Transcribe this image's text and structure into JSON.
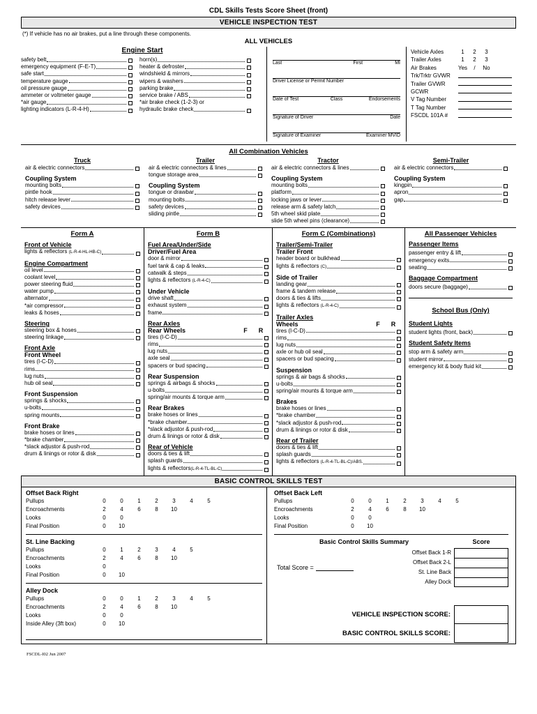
{
  "document": {
    "title": "CDL Skills Tests Score Sheet (front)",
    "band_vehicle_inspection": "VEHICLE INSPECTION TEST",
    "note": "(*) If vehicle has no air brakes, put a line through these components.",
    "all_vehicles_heading": "ALL VEHICLES",
    "band_basic_control": "BASIC CONTROL SKILLS TEST",
    "footer": "FSCDL-I02 Jun 2007"
  },
  "engine_start": {
    "title": "Engine Start",
    "left_items": [
      "safety belt",
      "emergency equipment (F-E-T)",
      "safe start",
      "temperature gauge",
      "oil pressure gauge",
      "ammeter or voltmeter gauge",
      "*air gauge",
      "lighting indicators (L-R-4-H)"
    ],
    "right_items": [
      "horn(s)",
      "heater & defroster",
      "windshield & mirrors",
      "wipers & washers",
      "parking brake",
      "service brake / ABS",
      "*air brake check (1-2-3) or",
      "hydraulic brake check"
    ]
  },
  "driver_form": {
    "name_labels": [
      "Last",
      "First",
      "MI"
    ],
    "license_label": "Driver License or Permit Number",
    "test_labels": [
      "Date of Test",
      "Class",
      "Endorsements"
    ],
    "driver_sig_labels": [
      "Signature of Driver",
      "Date"
    ],
    "examiner_sig_labels": [
      "Signature of Examiner",
      "Examiner MVID"
    ]
  },
  "vehicle_info": {
    "rows": [
      {
        "label": "Vehicle Axles",
        "options": [
          "1",
          "2",
          "3"
        ]
      },
      {
        "label": "Trailer Axles",
        "options": [
          "1",
          "2",
          "3"
        ]
      },
      {
        "label": "Air Brakes",
        "options": [
          "Yes",
          "/",
          "No"
        ]
      },
      {
        "label": "Trk/Trktr GVWR",
        "blank": true
      },
      {
        "label": "Trailer GVWR",
        "blank": true
      },
      {
        "label": "GCWR",
        "blank": true
      },
      {
        "label": "V Tag Number",
        "blank": true
      },
      {
        "label": "T Tag Number",
        "blank": true
      },
      {
        "label": "FSCDL 101A #",
        "blank": true
      }
    ]
  },
  "combination": {
    "heading": "All Combination Vehicles",
    "truck": {
      "title": "Truck",
      "items": [
        "air & electric connectors"
      ],
      "coupling_title": "Coupling System",
      "coupling_items": [
        "mounting bolts",
        "pintle hook",
        "hitch release lever",
        "safety devices"
      ]
    },
    "trailer": {
      "title": "Trailer",
      "items": [
        "air & electric connectors & lines",
        "tongue storage area"
      ],
      "coupling_title": "Coupling System",
      "coupling_items": [
        "tongue or drawbar",
        "mounting bolts",
        "safety devices",
        "sliding pintle"
      ]
    },
    "tractor": {
      "title": "Tractor",
      "items": [
        "air & electric connectors & lines"
      ],
      "coupling_title": "Coupling System",
      "coupling_items": [
        "mounting bolts",
        "platform",
        "locking jaws or lever",
        "release arm & safety latch",
        "5th wheel skid plate",
        "slide 5th wheel pins (clearance)"
      ]
    },
    "semi_trailer": {
      "title": "Semi-Trailer",
      "items": [
        "air & electric connectors"
      ],
      "coupling_title": "Coupling System",
      "coupling_items": [
        "kingpin",
        "apron",
        "gap"
      ]
    }
  },
  "form_a": {
    "title": "Form A",
    "groups": [
      {
        "heading": "Front of Vehicle",
        "items": [
          {
            "label": "lights & reflectors ",
            "small": "(L-R-4-HL-HB-C)"
          }
        ]
      },
      {
        "heading": "Engine Compartment",
        "items": [
          {
            "label": "oil level"
          },
          {
            "label": "coolant level"
          },
          {
            "label": "power steering fluid"
          },
          {
            "label": "water pump"
          },
          {
            "label": "alternator"
          },
          {
            "label": "*air compressor"
          },
          {
            "label": "leaks & hoses"
          }
        ]
      },
      {
        "heading": "Steering",
        "items": [
          {
            "label": "steering box & hoses"
          },
          {
            "label": "steering linkage"
          }
        ]
      },
      {
        "heading": "Front Axle",
        "subheading": "Front Wheel",
        "items": [
          {
            "label": "tires (I-C-D)"
          },
          {
            "label": "rims"
          },
          {
            "label": "lug nuts"
          },
          {
            "label": "hub oil seal"
          }
        ]
      },
      {
        "heading_plain": "Front Suspension",
        "items": [
          {
            "label": "springs & shocks"
          },
          {
            "label": "u-bolts"
          },
          {
            "label": "spring mounts"
          }
        ]
      },
      {
        "heading_plain": "Front Brake",
        "items": [
          {
            "label": "brake hoses or lines"
          },
          {
            "label": "*brake chamber"
          },
          {
            "label": "*slack adjustor & push-rod"
          },
          {
            "label": "drum & linings or rotor & disk"
          }
        ]
      }
    ]
  },
  "form_b": {
    "title": "Form B",
    "heading_fuel": "Fuel Area/Under/Side",
    "subheading_driver": "Driver/Fuel Area",
    "driver_items": [
      {
        "label": "door & mirror"
      },
      {
        "label": "fuel tank & cap & leaks"
      },
      {
        "label": "catwalk & steps"
      },
      {
        "label": "lights & reflectors ",
        "small": "(L-R-4-C)"
      }
    ],
    "under_vehicle_title": "Under Vehicle",
    "under_vehicle_items": [
      {
        "label": "drive shaft"
      },
      {
        "label": "exhaust system"
      },
      {
        "label": "frame"
      }
    ],
    "rear_axles_title": "Rear Axles",
    "rear_wheels_title": "Rear Wheels",
    "fr_labels": [
      "F",
      "R"
    ],
    "rear_wheel_items": [
      {
        "label": "tires (I-C-D)"
      },
      {
        "label": "rims"
      },
      {
        "label": "lug nuts"
      },
      {
        "label": "axle seal"
      },
      {
        "label": "spacers or bud spacing"
      }
    ],
    "rear_suspension_title": "Rear Suspension",
    "rear_suspension_items": [
      {
        "label": "springs & airbags & shocks"
      },
      {
        "label": "u-bolts"
      },
      {
        "label": "spring/air mounts & torque arm"
      }
    ],
    "rear_brakes_title": "Rear Brakes",
    "rear_brakes_items": [
      {
        "label": "brake hoses or lines"
      },
      {
        "label": "*brake chamber"
      },
      {
        "label": "*slack adjustor & push-rod"
      },
      {
        "label": "drum & linings or rotor & disk"
      }
    ],
    "rear_of_vehicle_title": "Rear of Vehicle",
    "rear_of_vehicle_items": [
      {
        "label": "doors & ties & lift"
      },
      {
        "label": "splash guards"
      },
      {
        "label": "lights & reflectors",
        "small": "(L-R-4-TL-BL-C)"
      }
    ]
  },
  "form_c": {
    "title": "Form C (Combinations)",
    "heading_trailer": "Trailer/Semi-Trailer",
    "subheading_front": "Trailer Front",
    "front_items": [
      {
        "label": "header board or bulkhead"
      },
      {
        "label": "lights & reflectors ",
        "small": "(C)"
      }
    ],
    "side_title": "Side of Trailer",
    "side_items": [
      {
        "label": "landing gear"
      },
      {
        "label": "frame & tandem release"
      },
      {
        "label": "doors & ties & lifts"
      },
      {
        "label": "lights & reflectors ",
        "small": "(L-R-4-C)"
      }
    ],
    "trailer_axles_title": "Trailer Axles",
    "wheels_title": "Wheels",
    "fr_labels": [
      "F",
      "R"
    ],
    "wheel_items": [
      {
        "label": "tires (I-C-D)"
      },
      {
        "label": "rims"
      },
      {
        "label": "lug nuts"
      },
      {
        "label": "axle or hub oil seal"
      },
      {
        "label": "spacers or bud spacing"
      }
    ],
    "suspension_title": "Suspension",
    "suspension_items": [
      {
        "label": "springs & air bags & shocks"
      },
      {
        "label": "u-bolts"
      },
      {
        "label": "spring/air mounts & torque arm"
      }
    ],
    "brakes_title": "Brakes",
    "brakes_items": [
      {
        "label": "brake hoses or lines"
      },
      {
        "label": "*brake chamber"
      },
      {
        "label": "*slack adjustor & push-rod"
      },
      {
        "label": "drum & linings or rotor & disk"
      }
    ],
    "rear_title": "Rear of Trailer",
    "rear_items": [
      {
        "label": "doors & ties & lift"
      },
      {
        "label": "splash guards"
      },
      {
        "label": "lights & reflectors ",
        "small": "(L-R-4-TL-BL-C)/ABS."
      }
    ]
  },
  "passenger": {
    "title": "All Passenger Vehicles",
    "items_title": "Passenger Items",
    "items": [
      {
        "label": "passenger entry & lift"
      },
      {
        "label": "emergency exits"
      },
      {
        "label": "seating"
      }
    ],
    "baggage_title": "Baggage Compartment",
    "baggage_items": [
      {
        "label": "doors secure (baggage)"
      }
    ],
    "school_bus_title": "School Bus (Only)",
    "student_lights_title": "Student Lights",
    "student_lights_items": [
      {
        "label": "student lights (front, back)"
      }
    ],
    "student_safety_title": "Student Safety Items",
    "student_safety_items": [
      {
        "label": "stop arm & safety arm"
      },
      {
        "label": "student mirror"
      },
      {
        "label": "emergency kit & body fluid kit"
      }
    ]
  },
  "basic_control": {
    "exercises_left": [
      {
        "name": "Offset Back Right",
        "rows": [
          {
            "label": "Pullups",
            "values": [
              "0",
              "0",
              "1",
              "2",
              "3",
              "4",
              "5"
            ]
          },
          {
            "label": "Encroachments",
            "values": [
              "2",
              "4",
              "6",
              "8",
              "10"
            ]
          },
          {
            "label": "Looks",
            "values": [
              "0",
              "0"
            ]
          },
          {
            "label": "Final Position",
            "values": [
              "0",
              "10"
            ]
          }
        ]
      },
      {
        "name": "St. Line Backing",
        "rows": [
          {
            "label": "Pullups",
            "values": [
              "0",
              "1",
              "2",
              "3",
              "4",
              "5"
            ]
          },
          {
            "label": "Encroachments",
            "values": [
              "2",
              "4",
              "6",
              "8",
              "10"
            ]
          },
          {
            "label": "Looks",
            "values": [
              "0"
            ]
          },
          {
            "label": "Final Position",
            "values": [
              "0",
              "10"
            ]
          }
        ]
      },
      {
        "name": "Alley Dock",
        "rows": [
          {
            "label": "Pullups",
            "values": [
              "0",
              "0",
              "1",
              "2",
              "3",
              "4",
              "5"
            ]
          },
          {
            "label": "Encroachments",
            "values": [
              "2",
              "4",
              "6",
              "8",
              "10"
            ]
          },
          {
            "label": "Looks",
            "values": [
              "0",
              "0"
            ]
          },
          {
            "label": "Inside Alley (3ft box)",
            "values": [
              "0",
              "10"
            ]
          }
        ]
      }
    ],
    "exercise_right": {
      "name": "Offset Back Left",
      "rows": [
        {
          "label": "Pullups",
          "values": [
            "0",
            "0",
            "1",
            "2",
            "3",
            "4",
            "5"
          ]
        },
        {
          "label": "Encroachments",
          "values": [
            "2",
            "4",
            "6",
            "8",
            "10"
          ]
        },
        {
          "label": "Looks",
          "values": [
            "0",
            "0"
          ]
        },
        {
          "label": "Final Position",
          "values": [
            "0",
            "10"
          ]
        }
      ]
    },
    "summary": {
      "title": "Basic Control Skills Summary",
      "score_header": "Score",
      "total_label": "Total Score =",
      "rows": [
        "Offset Back 1-R",
        "Offset Back 2-L",
        "St. Line Back",
        "Alley Dock"
      ]
    },
    "final_scores": [
      {
        "label": "VEHICLE INSPECTION SCORE:"
      },
      {
        "label": "BASIC CONTROL SKILLS SCORE:"
      }
    ]
  }
}
